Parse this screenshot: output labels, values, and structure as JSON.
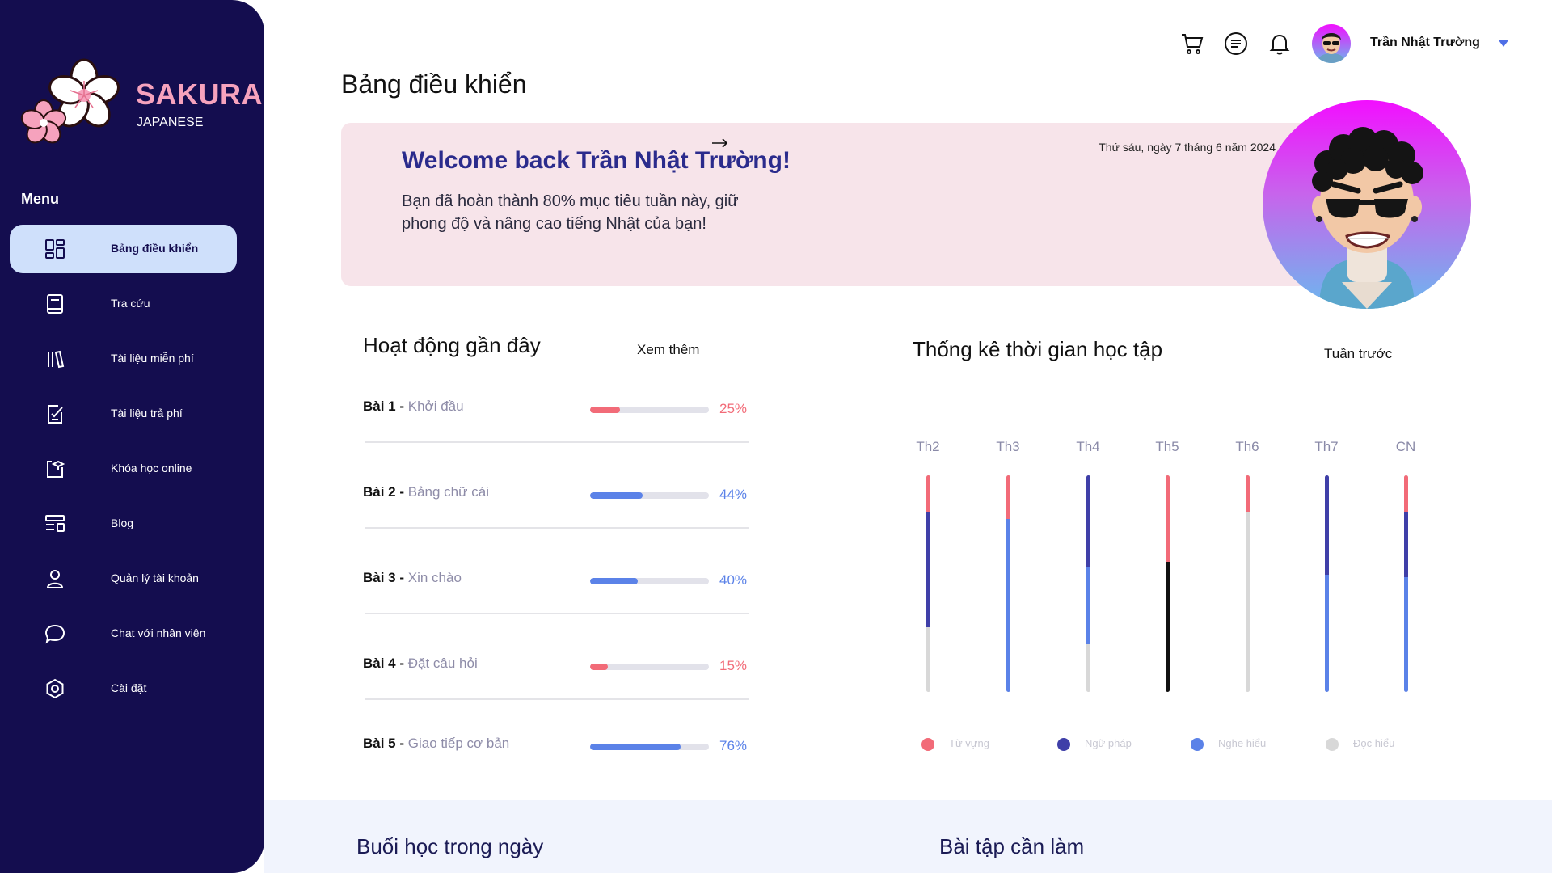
{
  "brand": {
    "name": "SAKURA",
    "subtitle": "JAPANESE"
  },
  "sidebar": {
    "menu_title": "Menu",
    "items": [
      {
        "label": "Bảng điều khiển",
        "icon": "dashboard-icon",
        "active": true
      },
      {
        "label": "Tra cứu",
        "icon": "book-icon"
      },
      {
        "label": "Tài liệu miễn phí",
        "icon": "library-icon"
      },
      {
        "label": "Tài liệu trả phí",
        "icon": "paid-document-icon"
      },
      {
        "label": "Khóa học online",
        "icon": "online-course-icon"
      },
      {
        "label": "Blog",
        "icon": "blog-icon"
      },
      {
        "label": "Quản lý tài khoản",
        "icon": "user-icon"
      },
      {
        "label": "Chat với nhân viên",
        "icon": "chat-icon"
      },
      {
        "label": "Cài đặt",
        "icon": "settings-icon"
      }
    ]
  },
  "header": {
    "title": "Bảng điều khiển",
    "user_name": "Trần Nhật Trường",
    "icons": [
      "cart-icon",
      "message-icon",
      "bell-icon",
      "avatar",
      "chevron-down-icon"
    ]
  },
  "banner": {
    "title": "Welcome back Trần Nhật Trường!",
    "message": "Bạn đã hoàn thành 80% mục tiêu tuần này, giữ phong độ và nâng cao tiếng Nhật của bạn!",
    "date": "Thứ sáu, ngày 7 tháng 6 năm 2024"
  },
  "recent": {
    "title": "Hoạt động gần đây",
    "see_more": "Xem thêm",
    "lessons": [
      {
        "num": "Bài 1 - ",
        "name": "Khởi đầu",
        "progress": 25,
        "pct": "25%",
        "color": "#f26b78"
      },
      {
        "num": "Bài 2 - ",
        "name": "Bảng chữ cái",
        "progress": 44,
        "pct": "44%",
        "color": "#5b82e8"
      },
      {
        "num": "Bài 3 - ",
        "name": "Xin chào",
        "progress": 40,
        "pct": "40%",
        "color": "#5b82e8"
      },
      {
        "num": "Bài 4 - ",
        "name": "Đặt câu hỏi",
        "progress": 15,
        "pct": "15%",
        "color": "#f26b78"
      },
      {
        "num": "Bài 5 - ",
        "name": "Giao tiếp cơ bản",
        "progress": 76,
        "pct": "76%",
        "color": "#5b82e8"
      }
    ]
  },
  "stats": {
    "title": "Thống kê thời gian học tập",
    "period": "Tuần trước"
  },
  "chart_data": {
    "type": "bar",
    "categories": [
      "Th2",
      "Th3",
      "Th4",
      "Th5",
      "Th6",
      "Th7",
      "CN"
    ],
    "colors": {
      "Từ vựng": "#f26b78",
      "Ngữ pháp": "#3f3fa8",
      "Nghe hiểu": "#5b82e8",
      "Đọc hiểu": "#d8d8d8",
      "Th5-lower": "#111111"
    },
    "series": [
      {
        "name": "Từ vựng",
        "values": [
          17,
          20,
          0,
          40,
          17,
          0,
          17
        ]
      },
      {
        "name": "Ngữ pháp",
        "values": [
          53,
          0,
          42,
          60,
          0,
          46,
          30
        ]
      },
      {
        "name": "Nghe hiểu",
        "values": [
          0,
          80,
          36,
          0,
          0,
          54,
          53
        ]
      },
      {
        "name": "Đọc hiểu",
        "values": [
          30,
          0,
          22,
          0,
          83,
          0,
          0
        ]
      }
    ],
    "ylim": [
      0,
      100
    ],
    "legend": [
      "Từ vựng",
      "Ngữ pháp",
      "Nghe hiểu",
      "Đọc hiểu"
    ],
    "legend_position": "bottom"
  },
  "bottom": {
    "today_title": "Buổi học trong ngày",
    "homework_title": "Bài tập cần làm"
  }
}
